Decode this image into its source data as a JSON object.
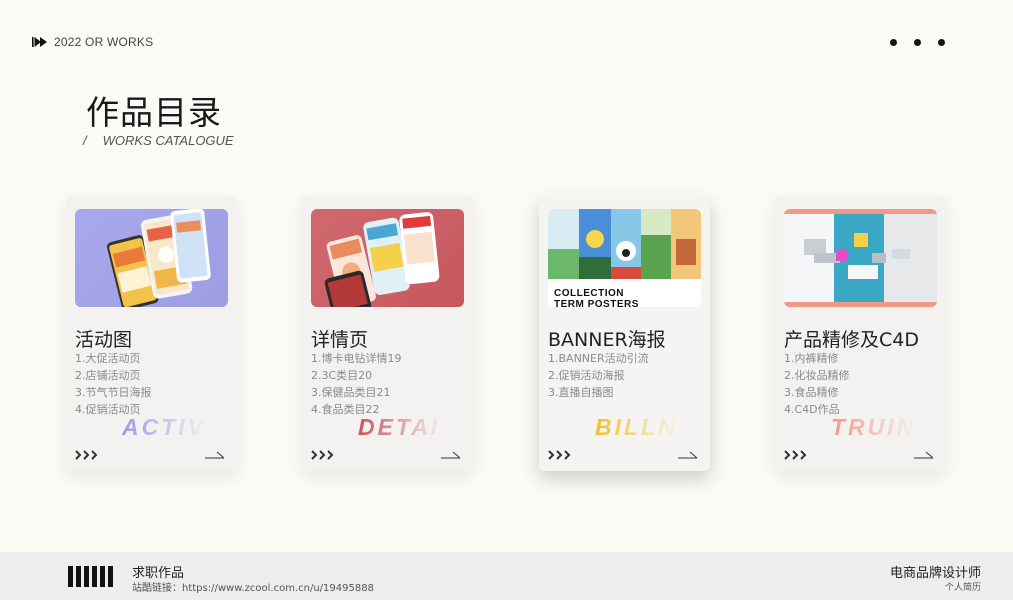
{
  "header": {
    "top_label": "2022 OR WORKS",
    "title": "作品目录",
    "subtitle_slash": "/",
    "subtitle": "WORKS CATALOGUE"
  },
  "cards": [
    {
      "title": "活动图",
      "items": [
        "1.大促活动页",
        "2.店铺活动页",
        "3.节气节日海报",
        "4.促销活动页"
      ],
      "watermark": "ACTIVITY",
      "accent": "#9b9be6"
    },
    {
      "title": "详情页",
      "items": [
        "1.博卡电钻详情19",
        "2.3C类目20",
        "3.保健品类目21",
        "4.食品类目22"
      ],
      "watermark": "DETAIL",
      "accent": "#c9555c"
    },
    {
      "title": "BANNER海报",
      "items": [
        "1.BANNER活动引流",
        "2.促销活动海报",
        "3.直播自播图"
      ],
      "watermark": "BILLNG",
      "accent": "#f2c022",
      "thumb_caption_1": "COLLECTION",
      "thumb_caption_2": "TERM POSTERS"
    },
    {
      "title": "产品精修及C4D",
      "items": [
        "1.内裤精修",
        "2.化妆品精修",
        "3.食品精修",
        "4.C4D作品"
      ],
      "watermark": "TRUING",
      "accent": "#ef9a86"
    }
  ],
  "footer": {
    "title": "求职作品",
    "link": "站酷链接：https://www.zcool.com.cn/u/19495888",
    "right_title": "电商品牌设计师",
    "right_sub": "个人简历"
  },
  "icons": {
    "top_left": "fast-forward-icon",
    "top_right": "more-dots-icon",
    "card_left": "triple-chevron-icon",
    "card_right": "arrow-right-icon",
    "footer_left": "barcode-icon"
  }
}
